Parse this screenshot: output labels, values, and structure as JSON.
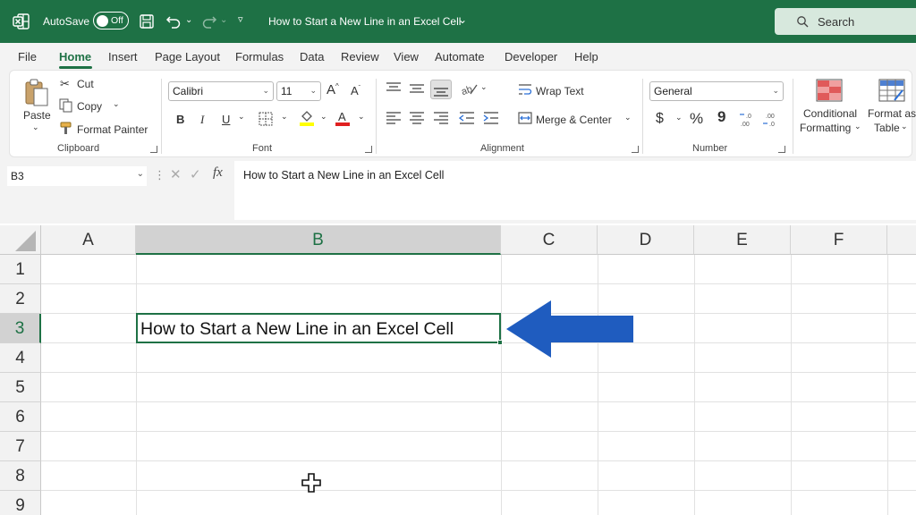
{
  "titlebar": {
    "autosave_label": "AutoSave",
    "autosave_state": "Off",
    "doc_title": "How to Start a New Line in an Excel Cell",
    "search_placeholder": "Search"
  },
  "menu": {
    "tabs": [
      "File",
      "Home",
      "Insert",
      "Page Layout",
      "Formulas",
      "Data",
      "Review",
      "View",
      "Automate",
      "Developer",
      "Help"
    ],
    "active": "Home"
  },
  "ribbon": {
    "clipboard": {
      "paste": "Paste",
      "cut": "Cut",
      "copy": "Copy",
      "format_painter": "Format Painter",
      "group": "Clipboard"
    },
    "font": {
      "name": "Calibri",
      "size": "11",
      "bold": "B",
      "italic": "I",
      "underline": "U",
      "group": "Font"
    },
    "alignment": {
      "wrap": "Wrap Text",
      "merge": "Merge & Center",
      "group": "Alignment"
    },
    "number": {
      "format": "General",
      "currency": "$",
      "percent": "%",
      "comma": "9",
      "group": "Number"
    },
    "styles": {
      "conditional_1": "Conditional",
      "conditional_2": "Formatting",
      "table_1": "Format as",
      "table_2": "Table"
    }
  },
  "formula_bar": {
    "name_box": "B3",
    "fx": "fx",
    "content": "How to Start a New Line in an Excel Cell"
  },
  "sheet": {
    "columns": [
      "A",
      "B",
      "C",
      "D",
      "E",
      "F"
    ],
    "rows": [
      "1",
      "2",
      "3",
      "4",
      "5",
      "6",
      "7",
      "8",
      "9"
    ],
    "selected_column": "B",
    "selected_row": "3",
    "cell_b3": "How to Start a New Line in an Excel Cell"
  },
  "colors": {
    "excel_green": "#1e7145",
    "arrow_blue": "#1f5cbf"
  }
}
